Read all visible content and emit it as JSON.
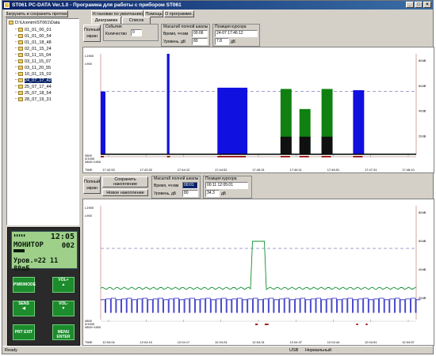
{
  "window": {
    "title": "ST061 PC-DATA Ver.1.0 - Программа для работы с прибором ST061"
  },
  "toolbar": {
    "load_save": "Загрузить и сохранить протокол",
    "defaults": "Установки по умолчанию",
    "help": "Помощь",
    "about": "О программе..."
  },
  "tree": {
    "root": "D:\\Ucenim\\ST061\\Data",
    "items": [
      "01_01_00_01",
      "01_01_00_54",
      "01_01_18_48",
      "02_01_15_24",
      "03_11_15_04",
      "03_11_15_07",
      "03_11_20_55",
      "10_01_15_02",
      "24_07_17_42",
      "25_07_17_44",
      "25_07_18_54",
      "28_07_19_31"
    ],
    "selected_index": 8
  },
  "top": {
    "tabs": [
      "Диаграмма",
      "Список"
    ],
    "fullscreen": "Полный экран",
    "events_title": "События",
    "count_label": "Количество",
    "count_value": "0",
    "scale_title": "Масштаб полной шкалы",
    "time_label": "Время, чч:мм",
    "time_value": "00:06",
    "level_label": "Уровень, дБ",
    "level_value": "80",
    "cursor_title": "Позиция курсора",
    "cursor_time": "24-07 17:46:12",
    "cursor_level": "7.8",
    "cursor_unit": "дБ",
    "y_left_top": "L1900",
    "y_left_2": "L900",
    "y_left_bottom": [
      "0800",
      "0/1900",
      "0800+1900"
    ],
    "y_right": [
      "80dB",
      "60dB",
      "40dB",
      "20dB"
    ],
    "time_prefix": "TIME",
    "x_ticks": [
      "17:42:53",
      "17:43:32",
      "17:44:12",
      "17:44:52",
      "17:45:31",
      "17:46:11",
      "17:46:51",
      "17:47:31",
      "17:48:10"
    ]
  },
  "bottom": {
    "fullscreen": "Полный экран",
    "save_realtime": "Сохранить накопление реального времени",
    "new_accum": "Новое накопление",
    "scale_title": "Масштаб полной шкалы",
    "time_label": "Время, чч:мм",
    "time_value": "00:01",
    "level_label": "Уровень, дБ",
    "level_value": "80",
    "cursor_title": "Позиция курсора",
    "cursor_time": "00:11 12:05:01",
    "cursor_level": "34.3",
    "cursor_unit": "дБ",
    "y_left_top": "L1900",
    "y_left_2": "L900",
    "y_left_bottom": [
      "0800",
      "0/1900",
      "0800+1900"
    ],
    "y_right": [
      "80dB",
      "60dB",
      "40dB",
      "20dB"
    ],
    "time_prefix": "TIME",
    "x_ticks": [
      "12:04:04",
      "12:04:10",
      "12:04:17",
      "12:04:24",
      "12:04:31",
      "12:04:37",
      "12:04:44",
      "12:04:51",
      "12:04:57"
    ]
  },
  "device": {
    "mode": "МОНИТОР",
    "clock": "12:05",
    "code": "002",
    "level_line": "Уров.=22 11 80дБ",
    "buttons": {
      "pwr": "PWR/MODE",
      "vol_up": "VOL+",
      "sens": "SENS",
      "vol_down": "VOL-",
      "prt": "PRT EXIT",
      "menu": "MENU ENTER"
    }
  },
  "status": {
    "left": "Ready",
    "port": "USB",
    "mode": "Нормальный"
  },
  "chart_data": [
    {
      "type": "bar",
      "title": "",
      "x": [
        "17:42:53",
        "17:43:32",
        "17:44:12",
        "17:44:52",
        "17:45:31",
        "17:46:11",
        "17:46:51",
        "17:47:31",
        "17:48:10"
      ],
      "ylim": [
        0,
        80
      ],
      "threshold_db": 50,
      "series": [
        {
          "values_db": [
            {
              "t": 0.0,
              "w": 0.015,
              "v": 50
            },
            {
              "t": 0.21,
              "w": 0.008,
              "v": 80
            },
            {
              "t": 0.37,
              "w": 0.095,
              "v": 53
            },
            {
              "t": 0.8,
              "w": 0.035,
              "v": 51
            }
          ],
          "color": "#1010e0"
        },
        {
          "values_db": [
            {
              "t": 0.57,
              "w": 0.035,
              "v": 52
            },
            {
              "t": 0.63,
              "w": 0.035,
              "v": 36
            },
            {
              "t": 0.7,
              "w": 0.035,
              "v": 52
            }
          ],
          "color": "#108010"
        },
        {
          "values_db": [
            {
              "t": 0.57,
              "w": 0.035,
              "v": 14
            },
            {
              "t": 0.63,
              "w": 0.035,
              "v": 14
            },
            {
              "t": 0.7,
              "w": 0.035,
              "v": 14
            }
          ],
          "color": "#101010"
        }
      ]
    },
    {
      "type": "line",
      "title": "",
      "x": [
        "12:04:04",
        "12:04:10",
        "12:04:17",
        "12:04:24",
        "12:04:31",
        "12:04:37",
        "12:04:44",
        "12:04:51",
        "12:04:57"
      ],
      "ylim": [
        0,
        80
      ],
      "threshold_db": 50,
      "series": [
        {
          "color": "#109030",
          "base_db": 22,
          "peak": {
            "from": 0.48,
            "to": 0.52,
            "v": 55
          }
        },
        {
          "color": "#2020c0",
          "base_db": 14,
          "dip_db": 5
        }
      ]
    }
  ]
}
